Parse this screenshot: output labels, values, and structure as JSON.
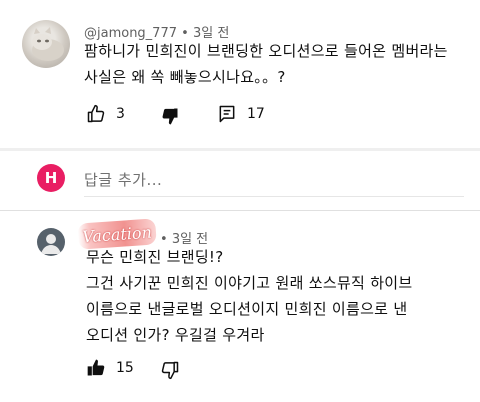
{
  "comments": [
    {
      "author": "@jamong_777",
      "separator": "•",
      "time": "3일 전",
      "lines": [
        "팜하니가 민희진이 브랜딩한 오디션으로 들어온 멤버라는",
        "사실은 왜 쏙 빼놓으시나요。。?"
      ],
      "likes": "3",
      "replies": "17",
      "icons": {
        "like": "thumbs-up-outline-icon",
        "dislike": "thumbs-down-filled-icon",
        "reply": "comment-icon"
      }
    },
    {
      "author_badge": "Vacation",
      "separator": "•",
      "time": "3일 전",
      "lines": [
        "무슨 민희진 브랜딩!?",
        "그건 사기꾼 민희진  이야기고 원래  쏘스뮤직 하이브",
        "이름으로 낸글로벌  오디션이지 민희진  이름으로 낸",
        "오디션  인가? 우길걸 우겨라"
      ],
      "likes": "15",
      "icons": {
        "like": "thumbs-up-filled-icon",
        "dislike": "thumbs-down-outline-icon"
      }
    }
  ],
  "reply_box": {
    "avatar_letter": "H",
    "avatar_color": "#e91e63",
    "placeholder": "답글 추가..."
  }
}
